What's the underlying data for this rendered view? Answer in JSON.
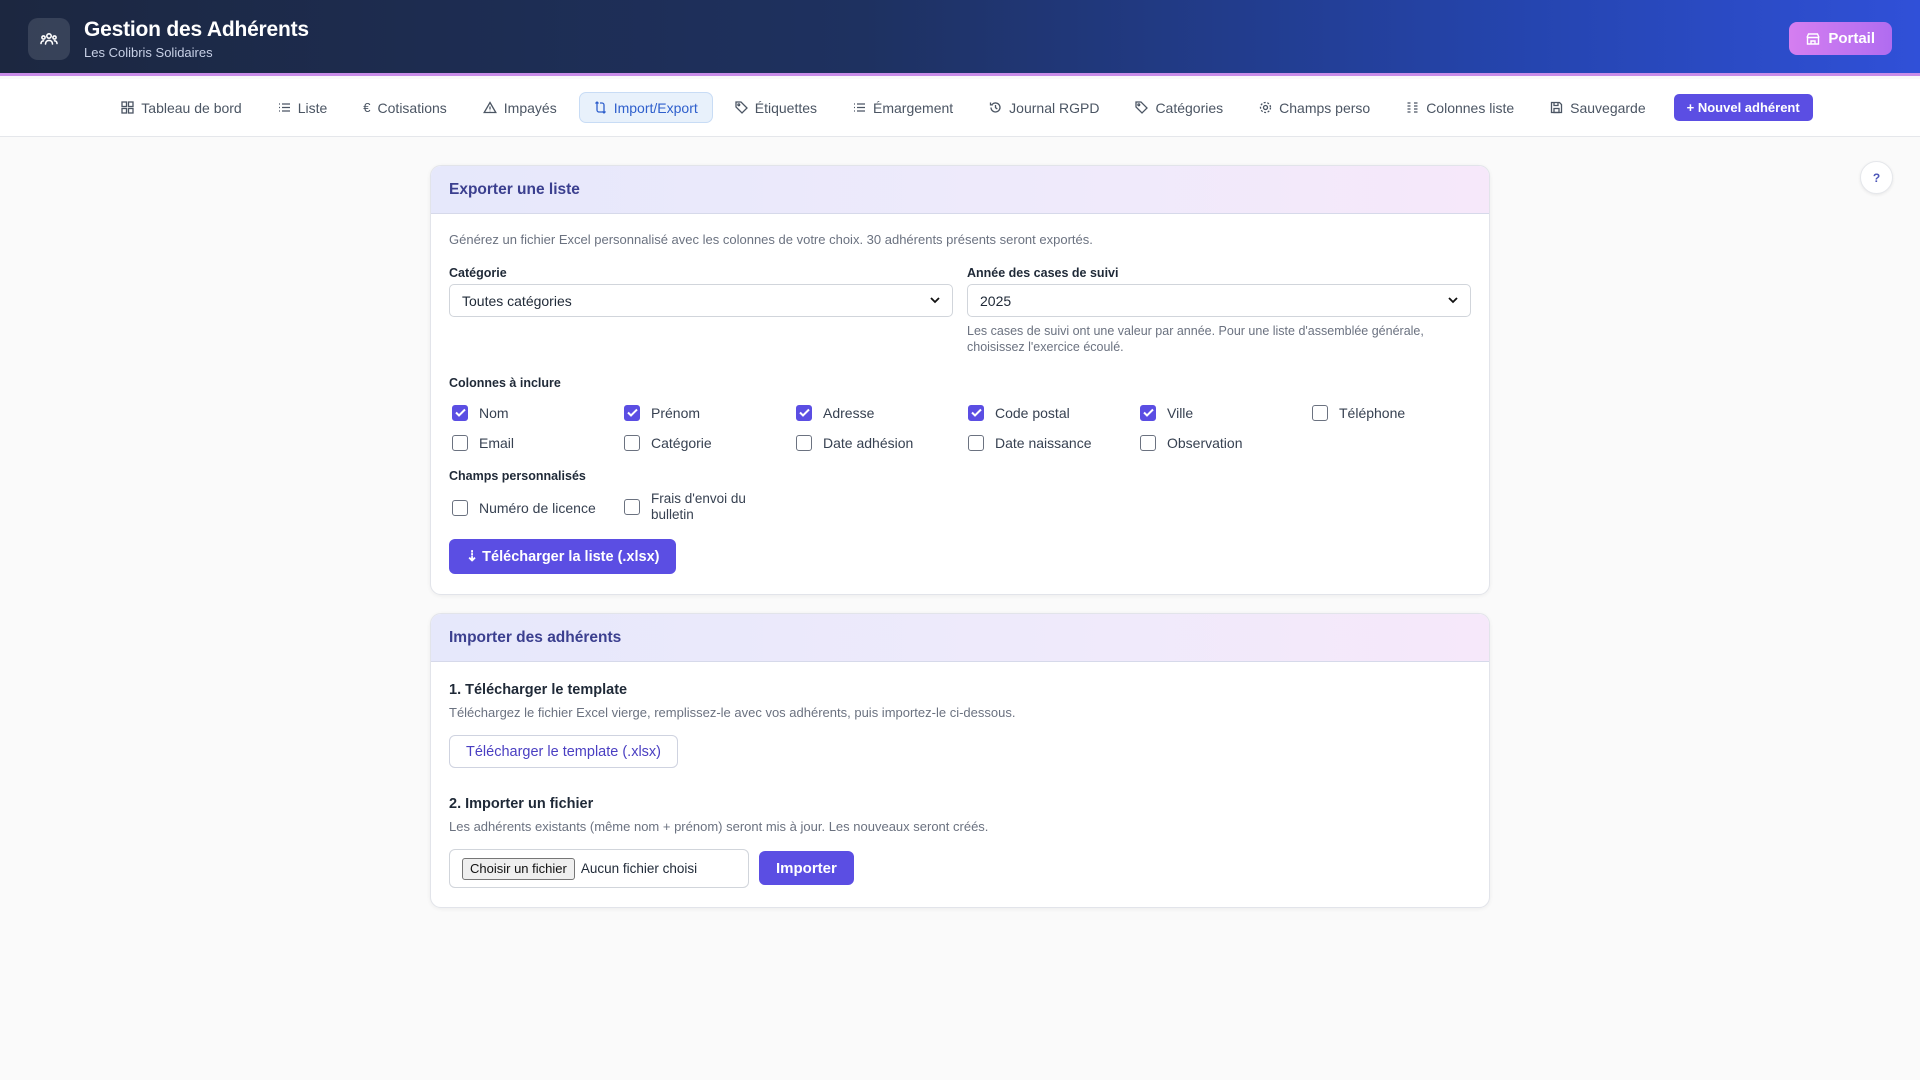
{
  "header": {
    "title": "Gestion des Adhérents",
    "subtitle": "Les Colibris Solidaires",
    "portal_label": "Portail",
    "logo_icon": "people-icon",
    "portal_icon": "store-icon"
  },
  "nav": {
    "items": [
      {
        "label": "Tableau de bord",
        "icon": "grid-icon"
      },
      {
        "label": "Liste",
        "icon": "list-icon"
      },
      {
        "label": "Cotisations",
        "icon": "euro-icon"
      },
      {
        "label": "Impayés",
        "icon": "warning-icon"
      },
      {
        "label": "Import/Export",
        "icon": "sync-icon",
        "active": true
      },
      {
        "label": "Étiquettes",
        "icon": "tag-icon"
      },
      {
        "label": "Émargement",
        "icon": "list-icon"
      },
      {
        "label": "Journal RGPD",
        "icon": "history-icon"
      },
      {
        "label": "Catégories",
        "icon": "tag-icon"
      },
      {
        "label": "Champs perso",
        "icon": "gear-icon"
      },
      {
        "label": "Colonnes liste",
        "icon": "columns-icon"
      },
      {
        "label": "Sauvegarde",
        "icon": "save-icon"
      }
    ],
    "new_member_label": "+ Nouvel adhérent"
  },
  "help_label": "?",
  "export": {
    "title": "Exporter une liste",
    "description": "Générez un fichier Excel personnalisé avec les colonnes de votre choix. 30 adhérents présents seront exportés.",
    "category_label": "Catégorie",
    "category_value": "Toutes catégories",
    "year_label": "Année des cases de suivi",
    "year_value": "2025",
    "year_hint_line1": "Les cases de suivi ont une valeur par année. Pour une liste d'assemblée générale,",
    "year_hint_line2": "choisissez l'exercice écoulé.",
    "columns_label": "Colonnes à inclure",
    "columns": [
      {
        "label": "Nom",
        "checked": true
      },
      {
        "label": "Prénom",
        "checked": true
      },
      {
        "label": "Adresse",
        "checked": true
      },
      {
        "label": "Code postal",
        "checked": true
      },
      {
        "label": "Ville",
        "checked": true
      },
      {
        "label": "Téléphone",
        "checked": false
      },
      {
        "label": "Email",
        "checked": false
      },
      {
        "label": "Catégorie",
        "checked": false
      },
      {
        "label": "Date adhésion",
        "checked": false
      },
      {
        "label": "Date naissance",
        "checked": false
      },
      {
        "label": "Observation",
        "checked": false
      }
    ],
    "custom_label": "Champs personnalisés",
    "custom_fields": [
      {
        "label_line1": "Numéro de licence",
        "label_line2": "",
        "checked": false
      },
      {
        "label_line1": "Frais d'envoi du",
        "label_line2": "bulletin",
        "checked": false
      }
    ],
    "download_label": "⇣ Télécharger la liste (.xlsx)"
  },
  "import": {
    "title": "Importer des adhérents",
    "step1_title": "1. Télécharger le template",
    "step1_desc": "Téléchargez le fichier Excel vierge, remplissez-le avec vos adhérents, puis importez-le ci-dessous.",
    "template_label": "Télécharger le template (.xlsx)",
    "step2_title": "2. Importer un fichier",
    "step2_desc": "Les adhérents existants (même nom + prénom) seront mis à jour. Les nouveaux seront créés.",
    "choose_file_label": "Choisir un fichier",
    "no_file_label": "Aucun fichier choisi",
    "import_label": "Importer"
  }
}
